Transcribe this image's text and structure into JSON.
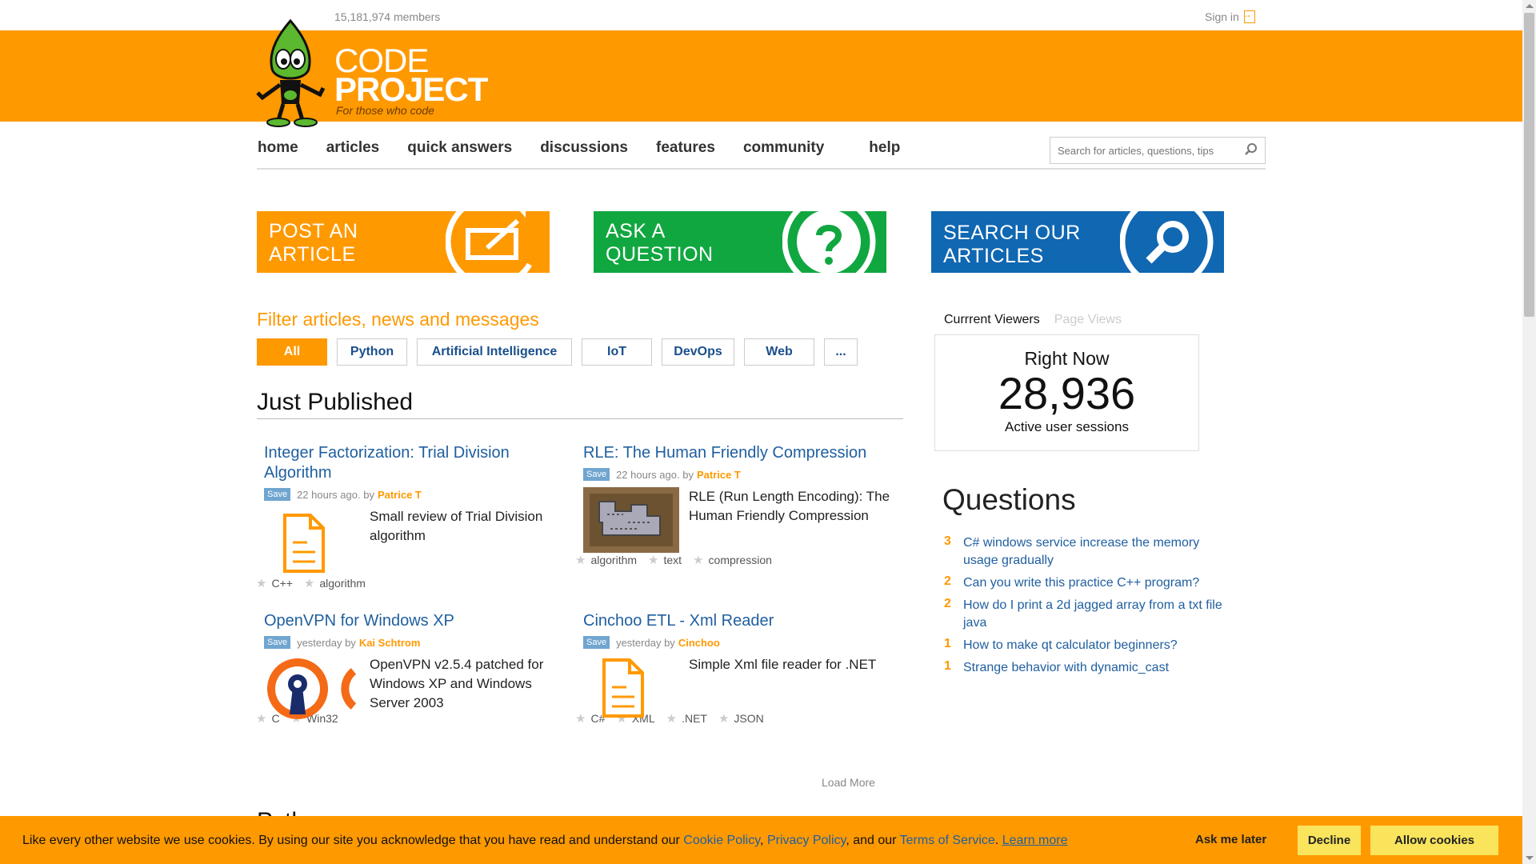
{
  "top": {
    "members": "15,181,974 members",
    "signin": "Sign in"
  },
  "logo": {
    "line1": "CODE",
    "line2": "PROJECT",
    "tagline": "For those who code"
  },
  "nav": {
    "items": [
      "home",
      "articles",
      "quick answers",
      "discussions",
      "features",
      "community",
      "help"
    ]
  },
  "search": {
    "placeholder": "Search for articles, questions, tips"
  },
  "banners": [
    {
      "line1": "POST AN",
      "line2": "ARTICLE",
      "icon": "edit-icon",
      "color": "#ff9900"
    },
    {
      "line1": "ASK A",
      "line2": "QUESTION",
      "icon": "question-icon",
      "color": "#11a740"
    },
    {
      "line1": "SEARCH OUR",
      "line2": "ARTICLES",
      "icon": "search-icon",
      "color": "#1067b2"
    }
  ],
  "filter": {
    "title": "Filter articles, news and messages",
    "buttons": [
      "All",
      "Python",
      "Artificial Intelligence",
      "IoT",
      "DevOps",
      "Web",
      "..."
    ]
  },
  "just_published": {
    "title": "Just Published",
    "save_label": "Save",
    "articles": [
      {
        "title": "Integer Factorization: Trial Division Algorithm",
        "time": "22 hours ago.",
        "by": "by",
        "author": "Patrice T",
        "description": "Small review of Trial Division algorithm",
        "tags": [
          "C++",
          "algorithm"
        ],
        "thumb": "document-icon"
      },
      {
        "title": "RLE: The Human Friendly Compression",
        "time": "22 hours ago.",
        "by": "by",
        "author": "Patrice T",
        "description": "RLE (Run Length Encoding): The Human Friendly Compression",
        "tags": [
          "algorithm",
          "text",
          "compression"
        ],
        "thumb": "pixel-image"
      },
      {
        "title": "OpenVPN for Windows XP",
        "time": "yesterday",
        "by": "by",
        "author": "Kai Schtrom",
        "description": "OpenVPN v2.5.4 patched for Windows XP and Windows Server 2003",
        "tags": [
          "C",
          "Win32"
        ],
        "thumb": "openvpn-logo"
      },
      {
        "title": "Cinchoo ETL - Xml Reader",
        "time": "yesterday",
        "by": "by",
        "author": "Cinchoo",
        "description": "Simple Xml file reader for .NET",
        "tags": [
          "C#",
          "XML",
          ".NET",
          "JSON"
        ],
        "thumb": "document-icon"
      }
    ],
    "load_more": "Load More",
    "next_section": "Python"
  },
  "viewers": {
    "tab_current": "Currrent Viewers",
    "tab_pages": "Page Views",
    "right_now": "Right Now",
    "count": "28,936",
    "label": "Active user sessions"
  },
  "questions": {
    "title": "Questions",
    "items": [
      {
        "count": "3",
        "text": "C# windows service increase the memory usage gradually"
      },
      {
        "count": "2",
        "text": "Can you write this practice C++ program?"
      },
      {
        "count": "2",
        "text": "How do I print a 2d jagged array from a txt file java"
      },
      {
        "count": "1",
        "text": "How to make qt calculator beginners?"
      },
      {
        "count": "1",
        "text": "Strange behavior with dynamic_cast"
      }
    ]
  },
  "cookie": {
    "text1": "Like every other website we use cookies. By using our site you acknowledge that you have read and understand our",
    "cookie_policy": "Cookie Policy",
    "comma": ",",
    "privacy_policy": "Privacy Policy",
    "and_our": ", and our",
    "terms": "Terms of Service",
    "period": ".",
    "learn_more": "Learn more",
    "ask_later": "Ask me later",
    "decline": "Decline",
    "allow": "Allow cookies"
  },
  "colors": {
    "accent": "#ff9900",
    "link": "#1f5fa0",
    "green": "#11a740",
    "blue": "#1067b2"
  }
}
